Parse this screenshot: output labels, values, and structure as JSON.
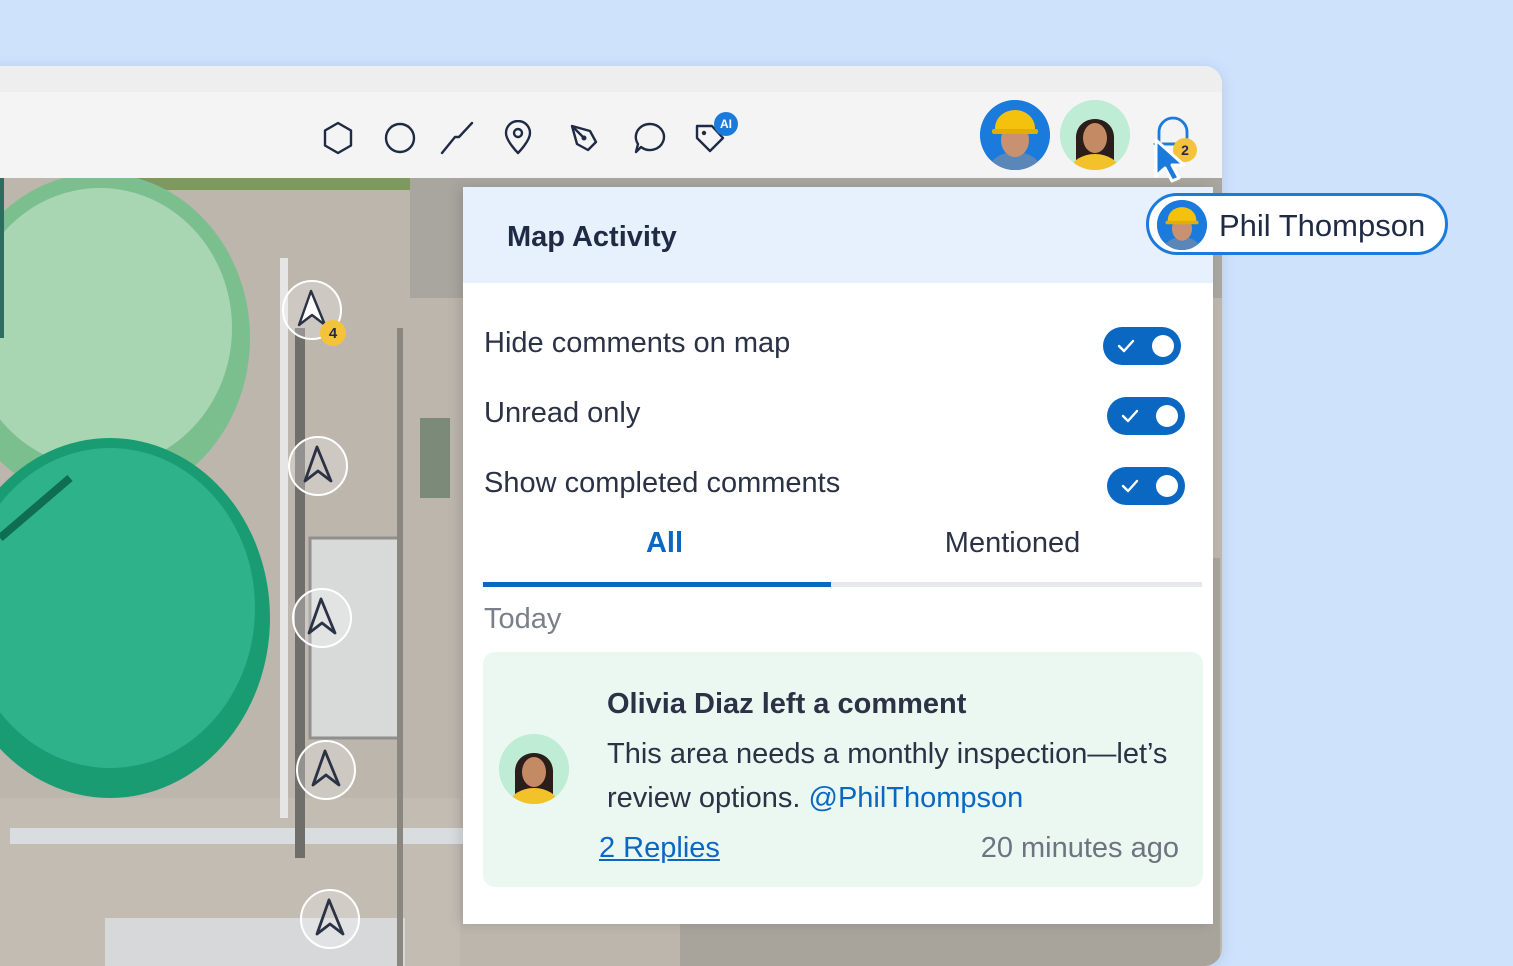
{
  "toolbar": {
    "tools": [
      "polygon-icon",
      "circle-icon",
      "line-icon",
      "pin-icon",
      "pen-icon",
      "comment-icon",
      "ai-tag-icon"
    ],
    "ai_badge": "AI",
    "avatars": [
      "worker-avatar",
      "woman-avatar"
    ],
    "notification_count": "2"
  },
  "map": {
    "marker_count": "4"
  },
  "cursor_user": {
    "name": "Phil Thompson"
  },
  "panel": {
    "title": "Map Activity",
    "options": [
      {
        "label": "Hide comments on map",
        "on": true
      },
      {
        "label": "Unread only",
        "on": true
      },
      {
        "label": "Show completed comments",
        "on": true
      }
    ],
    "tabs": [
      {
        "label": "All",
        "active": true
      },
      {
        "label": "Mentioned",
        "active": false
      }
    ],
    "section": "Today",
    "comment": {
      "title": "Olivia Diaz left a comment",
      "body": "This area needs a monthly inspection—let’s review options.",
      "mention": "@PhilThompson",
      "replies": "2 Replies",
      "time": "20 minutes ago"
    }
  },
  "colors": {
    "accent": "#0b68c2",
    "background": "#cfe2fc",
    "panel_header": "#e7f0fd",
    "card": "#ebf8f2",
    "badge": "#f5c33b"
  }
}
